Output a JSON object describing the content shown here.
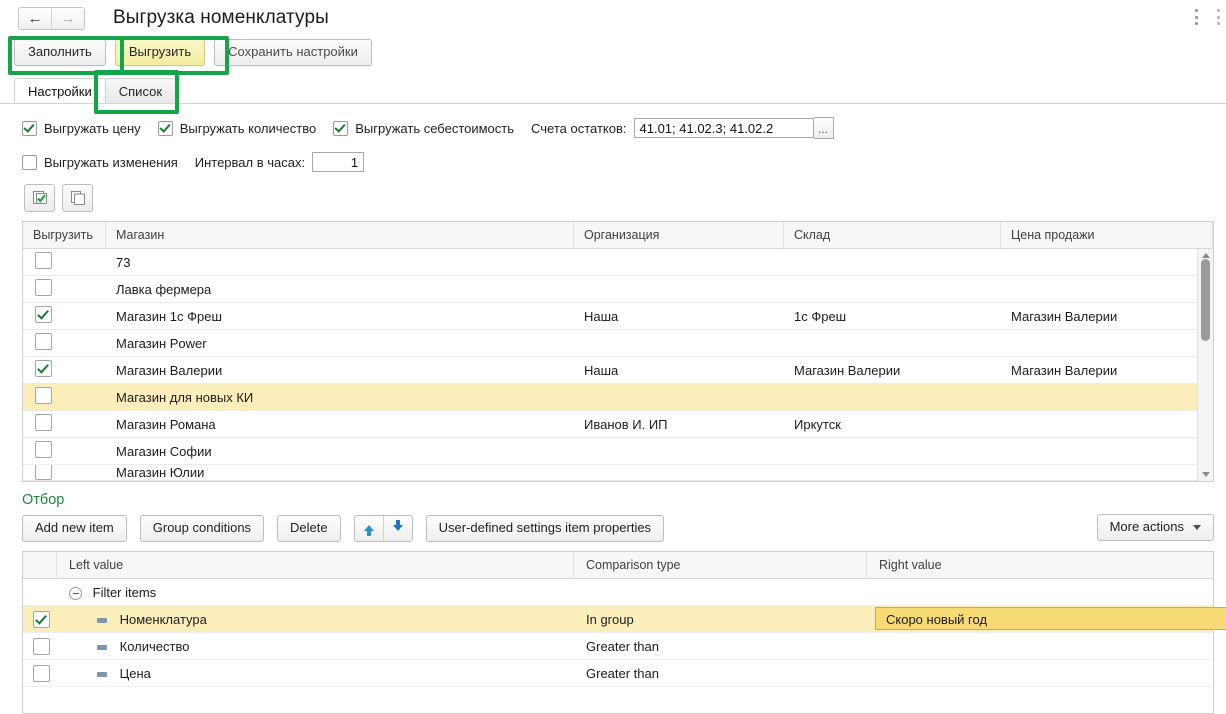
{
  "window": {
    "title": "Выгрузка номенклатуры",
    "nav": {
      "back_icon": "arrow-left-icon",
      "forward_icon": "arrow-right-icon"
    },
    "menu_icon": "vertical-ellipsis-icon"
  },
  "command_bar": {
    "buttons": [
      {
        "label": "Заполнить",
        "style": "default",
        "highlighted": true
      },
      {
        "label": "Выгрузить",
        "style": "yellow",
        "highlighted": true
      },
      {
        "label": "Сохранить настройки",
        "style": "muted",
        "highlighted": false
      }
    ]
  },
  "tabs": [
    {
      "label": "Настройки",
      "active": true,
      "highlighted": false
    },
    {
      "label": "Список",
      "active": false,
      "highlighted": true
    }
  ],
  "settings": {
    "options": [
      {
        "label": "Выгружать цену",
        "checked": true
      },
      {
        "label": "Выгружать количество",
        "checked": true
      },
      {
        "label": "Выгружать себестоимость",
        "checked": true
      }
    ],
    "accounts_label": "Счета остатков:",
    "accounts_value": "41.01; 41.02.3; 41.02.2",
    "accounts_picker": "...",
    "changes_option": {
      "label": "Выгружать изменения",
      "checked": false
    },
    "interval_label": "Интервал в часах:",
    "interval_value": "1",
    "icon_buttons": [
      {
        "name": "check-all-icon",
        "title": ""
      },
      {
        "name": "copy-rows-icon",
        "title": ""
      }
    ]
  },
  "grid": {
    "columns": [
      "Выгрузить",
      "Магазин",
      "Организация",
      "Склад",
      "Цена продажи"
    ],
    "rows": [
      {
        "checked": false,
        "shop": "73",
        "org": "",
        "warehouse": "",
        "price": "",
        "highlight": false
      },
      {
        "checked": false,
        "shop": "Лавка фермера",
        "org": "",
        "warehouse": "",
        "price": "",
        "highlight": false
      },
      {
        "checked": true,
        "shop": "Магазин 1с Фреш",
        "org": "Наша",
        "warehouse": "1с Фреш",
        "price": "Магазин Валерии",
        "highlight": false
      },
      {
        "checked": false,
        "shop": "Магазин Power",
        "org": "",
        "warehouse": "",
        "price": "",
        "highlight": false
      },
      {
        "checked": true,
        "shop": "Магазин Валерии",
        "org": "Наша",
        "warehouse": "Магазин Валерии",
        "price": "Магазин Валерии",
        "highlight": false
      },
      {
        "checked": false,
        "shop": "Магазин для новых КИ",
        "org": "",
        "warehouse": "",
        "price": "",
        "highlight": true
      },
      {
        "checked": false,
        "shop": "Магазин Романа",
        "org": "Иванов И. ИП",
        "warehouse": "Иркутск",
        "price": "",
        "highlight": false
      },
      {
        "checked": false,
        "shop": "Магазин Софии",
        "org": "",
        "warehouse": "",
        "price": "",
        "highlight": false
      },
      {
        "checked": false,
        "shop": "Магазин Юлии",
        "org": "",
        "warehouse": "",
        "price": "",
        "highlight": false
      }
    ]
  },
  "filter": {
    "title": "Отбор",
    "toolbar": {
      "add": "Add new item",
      "group": "Group conditions",
      "delete": "Delete",
      "move_up_icon": "arrow-up-icon",
      "move_down_icon": "arrow-down-icon",
      "properties": "User-defined settings item properties",
      "more_actions": "More actions"
    },
    "columns": [
      "Left value",
      "Comparison type",
      "Right value"
    ],
    "group_row": {
      "label": "Filter items",
      "expander_icon": "collapse-icon"
    },
    "rows": [
      {
        "checked": true,
        "left": "Номенклатура",
        "comparison": "In group",
        "right": "Скоро новый год",
        "highlight": true
      },
      {
        "checked": false,
        "left": "Количество",
        "comparison": "Greater than",
        "right": "",
        "highlight": false
      },
      {
        "checked": false,
        "left": "Цена",
        "comparison": "Greater than",
        "right": "",
        "highlight": false
      }
    ]
  },
  "colors": {
    "annotation": "#17a349",
    "accent_yellow": "#f2eda0",
    "row_highlight": "#fbeebb",
    "section_title": "#1a8a3c"
  }
}
